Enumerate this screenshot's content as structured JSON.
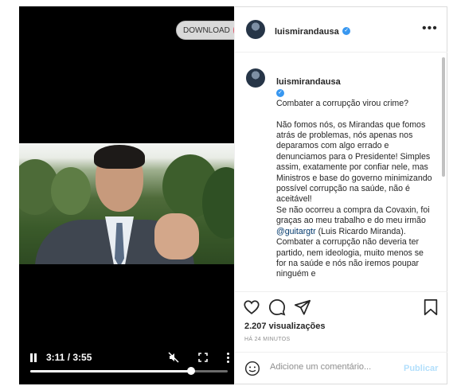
{
  "video": {
    "download_label": "DOWNLOAD",
    "time": "3:11 / 3:55",
    "progress_fraction": 0.815
  },
  "post": {
    "username": "luismirandausa",
    "more_label": "•••",
    "caption_title": "Combater a corrupção virou crime?",
    "caption_body": "Não fomos nós, os Mirandas que fomos atrás de problemas, nós apenas nos deparamos com algo errado e denunciamos para o Presidente! Simples assim, exatamente por confiar nele, mas Ministros e base do governo minimizando possível corrupção na saúde, não é aceitável!\nSe não ocorreu a compra da Covaxin, foi graças ao meu trabalho e do meu irmão ",
    "mention": "@guitargtr",
    "caption_tail": " (Luis Ricardo Miranda).\nCombater a corrupção não deveria ter partido, nem ideologia, muito menos se for na saúde e nós não iremos poupar ninguém e",
    "views": "2.207 visualizações",
    "time_ago": "HÁ 24 MINUTOS"
  },
  "comment": {
    "placeholder": "Adicione um comentário...",
    "publish_label": "Publicar"
  },
  "colors": {
    "verified": "#3897f0",
    "mention": "#00376b",
    "publish_disabled": "#b2dffc"
  }
}
